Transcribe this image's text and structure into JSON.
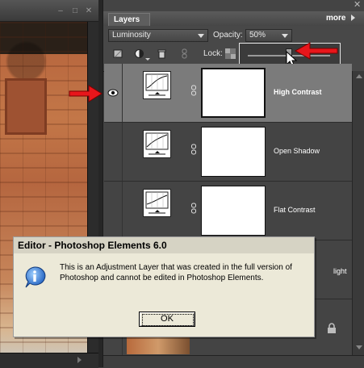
{
  "panel": {
    "tab_label": "Layers",
    "more_label": "more",
    "blend_mode": "Luminosity",
    "opacity_label": "Opacity:",
    "opacity_value": "50%",
    "lock_label": "Lock:",
    "opacity_slider_fraction": 0.5
  },
  "layers": [
    {
      "name": "High Contrast",
      "visible": true,
      "selected": true
    },
    {
      "name": "Open Shadow",
      "visible": false,
      "selected": false
    },
    {
      "name": "Flat Contrast",
      "visible": false,
      "selected": false
    },
    {
      "name": "light",
      "visible": false,
      "selected": false
    }
  ],
  "dialog": {
    "title": "Editor - Photoshop Elements 6.0",
    "message": "This is an Adjustment Layer that was created in the full version of Photoshop and cannot be edited in Photoshop Elements.",
    "ok_label": "OK"
  },
  "colors": {
    "panel_bg": "#444444",
    "selected_row": "#7b7b7b",
    "annotation_arrow": "#e8161b",
    "dialog_bg": "#ece9d8"
  }
}
